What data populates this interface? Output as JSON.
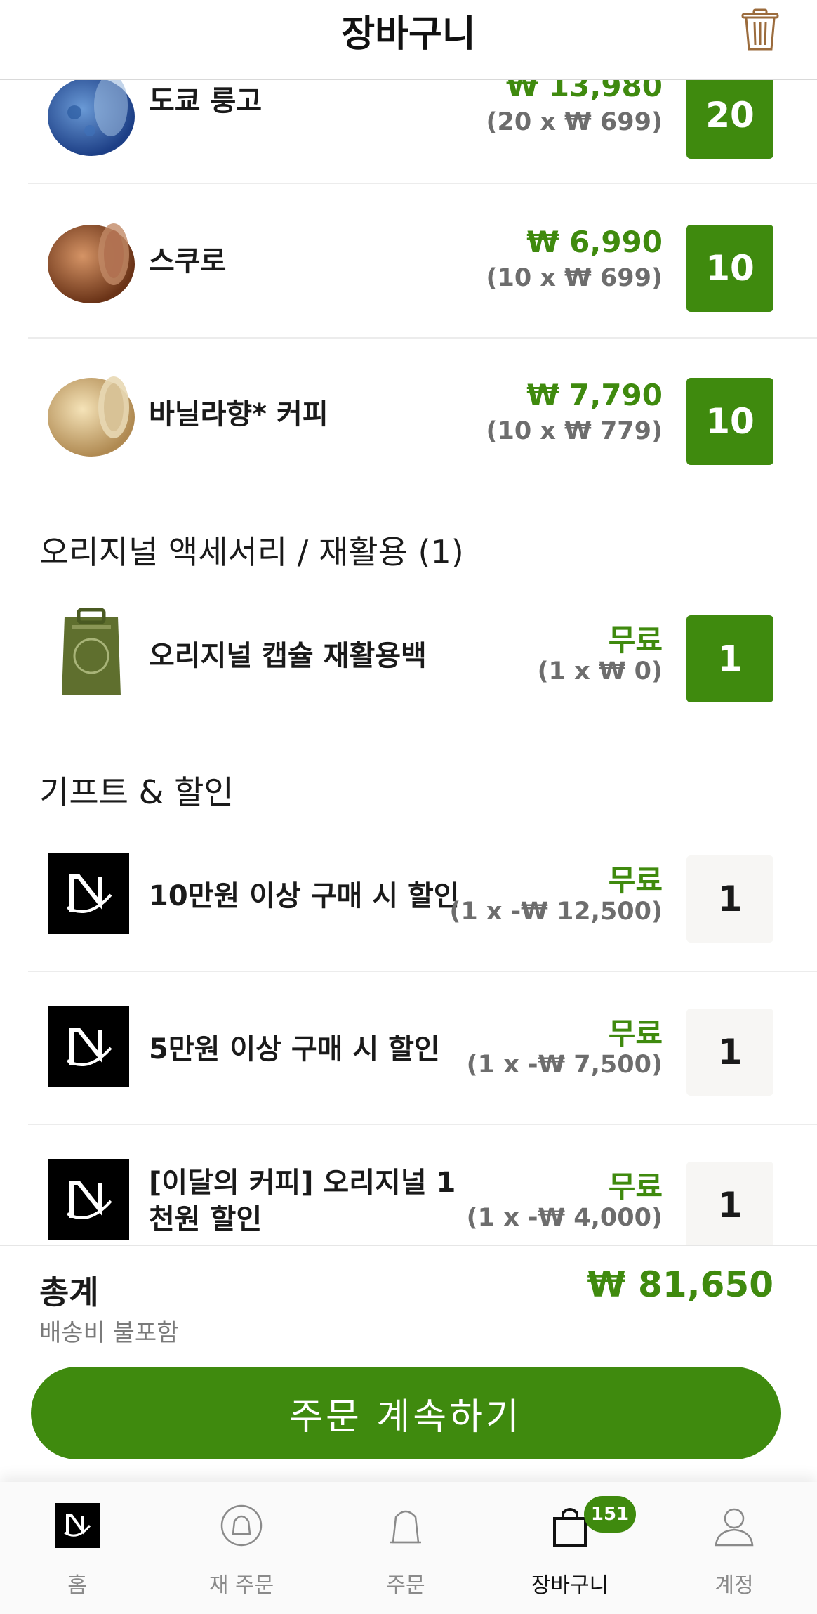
{
  "header": {
    "title": "장바구니"
  },
  "coffee_items": [
    {
      "name": "도쿄 룽고",
      "price": "₩ 13,980",
      "detail": "(20 x ₩ 699)",
      "qty": "20",
      "color": "blue"
    },
    {
      "name": "스쿠로",
      "price": "₩ 6,990",
      "detail": "(10 x ₩ 699)",
      "qty": "10",
      "color": "brown"
    },
    {
      "name": "바닐라향* 커피",
      "price": "₩ 7,790",
      "detail": "(10 x ₩ 779)",
      "qty": "10",
      "color": "beige"
    }
  ],
  "accessories": {
    "title": "오리지널 액세서리 / 재활용 (1)",
    "items": [
      {
        "name": "오리지널 캡슐 재활용백",
        "price": "무료",
        "detail": "(1 x ₩ 0)",
        "qty": "1"
      }
    ]
  },
  "gifts": {
    "title": "기프트 & 할인",
    "items": [
      {
        "name": "10만원 이상 구매 시 할인",
        "price": "무료",
        "detail": "(1 x -₩ 12,500)",
        "qty": "1"
      },
      {
        "name": "5만원 이상 구매 시 할인",
        "price": "무료",
        "detail": "(1 x -₩ 7,500)",
        "qty": "1"
      },
      {
        "name": "[이달의 커피] 오리지널 1 천원 할인",
        "price": "무료",
        "detail": "(1 x -₩ 4,000)",
        "qty": "1"
      }
    ]
  },
  "total": {
    "label": "총계",
    "note": "배송비 불포함",
    "value": "₩ 81,650"
  },
  "checkout_label": "주문 계속하기",
  "tabs": [
    {
      "label": "홈",
      "icon": "nespresso-logo-icon"
    },
    {
      "label": "재 주문",
      "icon": "bell-reorder-icon"
    },
    {
      "label": "주문",
      "icon": "bell-order-icon"
    },
    {
      "label": "장바구니",
      "icon": "shopping-bag-icon",
      "badge": "151",
      "active": true
    },
    {
      "label": "계정",
      "icon": "person-icon"
    }
  ],
  "colors": {
    "accent": "#3f8a0e",
    "muted": "#6d6d6d"
  }
}
